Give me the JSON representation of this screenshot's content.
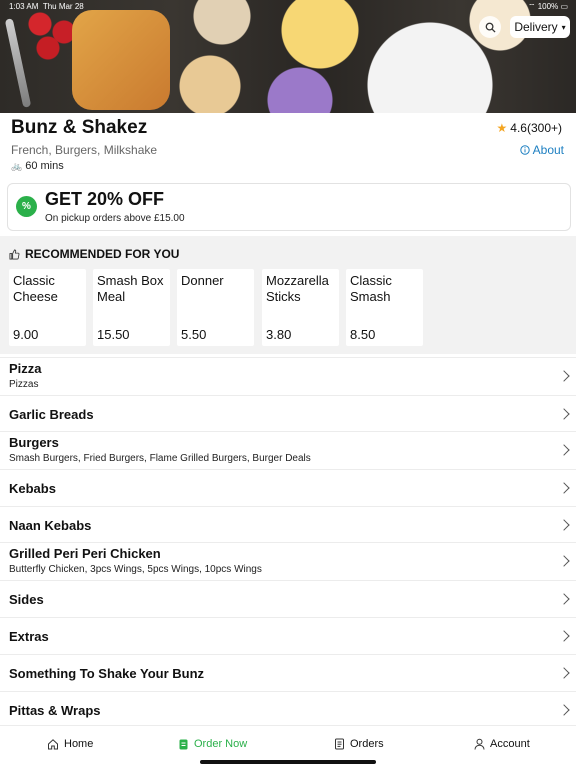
{
  "status": {
    "time": "1:03 AM",
    "date": "Thu Mar 28",
    "battery": "100%"
  },
  "header": {
    "delivery_label": "Delivery"
  },
  "restaurant": {
    "name": "Bunz & Shakez",
    "cuisines": "French, Burgers, Milkshake",
    "time": "60 mins",
    "rating": "4.6(300+)",
    "about_label": "About"
  },
  "promo": {
    "title": "GET 20% OFF",
    "subtitle": "On pickup orders above £15.00",
    "badge": "%"
  },
  "recommended": {
    "heading": "RECOMMENDED FOR YOU",
    "items": [
      {
        "name": "Classic Cheese",
        "price": "9.00"
      },
      {
        "name": "Smash Box Meal",
        "price": "15.50"
      },
      {
        "name": "Donner",
        "price": "5.50"
      },
      {
        "name": "Mozzarella Sticks",
        "price": "3.80"
      },
      {
        "name": "Classic Smash",
        "price": "8.50"
      }
    ]
  },
  "categories": [
    {
      "title": "Pizza",
      "sub": "Pizzas"
    },
    {
      "title": "Garlic Breads",
      "sub": ""
    },
    {
      "title": "Burgers",
      "sub": "Smash Burgers, Fried Burgers, Flame Grilled Burgers, Burger Deals"
    },
    {
      "title": "Kebabs",
      "sub": ""
    },
    {
      "title": "Naan Kebabs",
      "sub": ""
    },
    {
      "title": "Grilled Peri Peri Chicken",
      "sub": "Butterfly Chicken, 3pcs Wings, 5pcs Wings, 10pcs Wings"
    },
    {
      "title": "Sides",
      "sub": ""
    },
    {
      "title": "Extras",
      "sub": ""
    },
    {
      "title": "Something To Shake Your Bunz",
      "sub": ""
    },
    {
      "title": "Pittas & Wraps",
      "sub": ""
    }
  ],
  "tabs": [
    {
      "label": "Home",
      "icon": "home-icon"
    },
    {
      "label": "Order Now",
      "icon": "order-icon"
    },
    {
      "label": "Orders",
      "icon": "receipt-icon"
    },
    {
      "label": "Account",
      "icon": "person-icon"
    }
  ],
  "colors": {
    "accent_green": "#2bb04a",
    "link_blue": "#1d7fc1",
    "star": "#f4a521"
  }
}
